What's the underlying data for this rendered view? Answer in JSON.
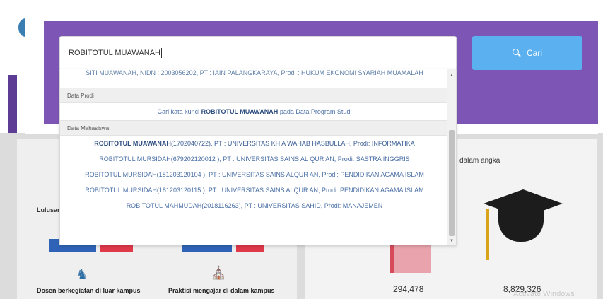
{
  "search": {
    "query": "ROBITOTUL MUAWANAH",
    "button_label": "Cari"
  },
  "dropdown": {
    "first_result": "SITI MUAWANAH, NIDN : 2003056202, PT : IAIN PALANGKARAYA, Prodi : HUKUM EKONOMI SYARIAH MUAMALAH",
    "categories": {
      "prodi": "Data Prodi",
      "mahasiswa": "Data Mahasiswa"
    },
    "prodi_suggestion": {
      "prefix": "Cari kata kunci ",
      "keyword": "ROBITOTUL MUAWANAH",
      "suffix": " pada Data Program Studi"
    },
    "mahasiswa_results": [
      {
        "name": "ROBITOTUL MUAWANAH",
        "rest": "(1702040722), PT : UNIVERSITAS KH A WAHAB HASBULLAH, Prodi: INFORMATIKA"
      },
      {
        "name": "ROBITOTUL MURSIDAH",
        "rest": "(679202120012 ), PT : UNIVERSITAS SAINS AL QUR AN, Prodi: SASTRA INGGRIS"
      },
      {
        "name": "ROBITOTUL MURSIDAH",
        "rest": "(181203120104 ), PT : UNIVERSITAS SAINS ALQUR AN, Prodi: PENDIDIKAN AGAMA ISLAM"
      },
      {
        "name": "ROBITOTUL MURSIDAH",
        "rest": "(181203120115 ), PT : UNIVERSITAS SAINS ALQUR AN, Prodi: PENDIDIKAN AGAMA ISLAM"
      },
      {
        "name": "ROBITOTUL MAHMUDAH",
        "rest": "(2018116263), PT : UNIVERSITAS SAHID, Prodi: MANAJEMEN"
      }
    ]
  },
  "background": {
    "lulusan_label": "Lulusan",
    "dalam_angka": "dalam angka",
    "dosen_label": "Dosen berkegiatan di luar kampus",
    "praktisi_label": "Praktisi mengajar di dalam kampus",
    "stat_1": "294,478",
    "stat_2": "8,829,326",
    "watermark": "Activate Windows"
  },
  "icons": {
    "search": "search-icon",
    "scroll_up": "scroll-up-arrow-icon",
    "scroll_down": "scroll-down-arrow-icon",
    "graduation_cap": "graduation-cap-icon",
    "people": "people-icon",
    "building": "building-icon"
  },
  "colors": {
    "panel_purple": "#7c55b5",
    "search_button_blue": "#5bb0ef",
    "result_link": "#4a6fa5"
  }
}
